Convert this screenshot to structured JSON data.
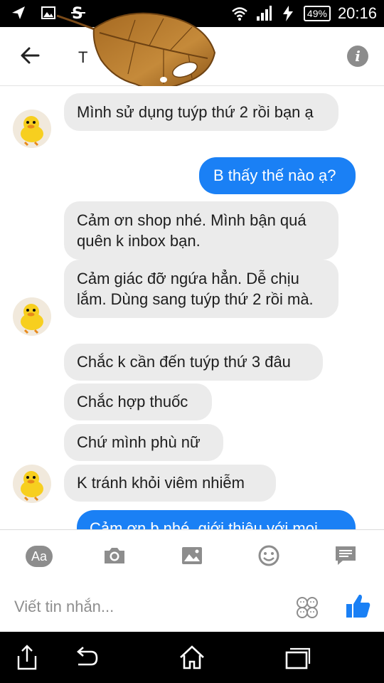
{
  "status_bar": {
    "battery": "49%",
    "time": "20:16"
  },
  "header": {
    "contact_name": "T",
    "icons": [
      "back-arrow-icon",
      "info-icon"
    ]
  },
  "messages": [
    {
      "side": "incoming",
      "text": "Mình sử dụng tuýp thứ 2 rồi bạn ạ"
    },
    {
      "side": "outgoing",
      "text": "B thấy thế nào ạ?"
    },
    {
      "side": "incoming",
      "text": "Cảm ơn shop nhé. Mình bận quá quên k inbox bạn."
    },
    {
      "side": "incoming",
      "text": "Cảm giác đỡ ngứa hẳn. Dễ chịu lắm. Dùng sang tuýp thứ 2 rồi mà."
    },
    {
      "side": "incoming",
      "text": "Chắc k cần đến tuýp thứ 3 đâu"
    },
    {
      "side": "incoming",
      "text": "Chắc hợp thuốc"
    },
    {
      "side": "incoming",
      "text": "Chứ mình phù nữ"
    },
    {
      "side": "incoming",
      "text": "K tránh khỏi viêm nhiễm"
    },
    {
      "side": "outgoing",
      "text": "Cảm ơn b nhé, giới thiệu với mọi"
    }
  ],
  "composer": {
    "aa_label": "Aa",
    "placeholder": "Viết tin nhắn...",
    "tools": [
      "camera-icon",
      "gallery-icon",
      "emoji-icon",
      "quick-reply-icon"
    ]
  },
  "colors": {
    "outgoing_bubble": "#1a80f5",
    "incoming_bubble": "#ebebeb",
    "like": "#1a80f5"
  }
}
